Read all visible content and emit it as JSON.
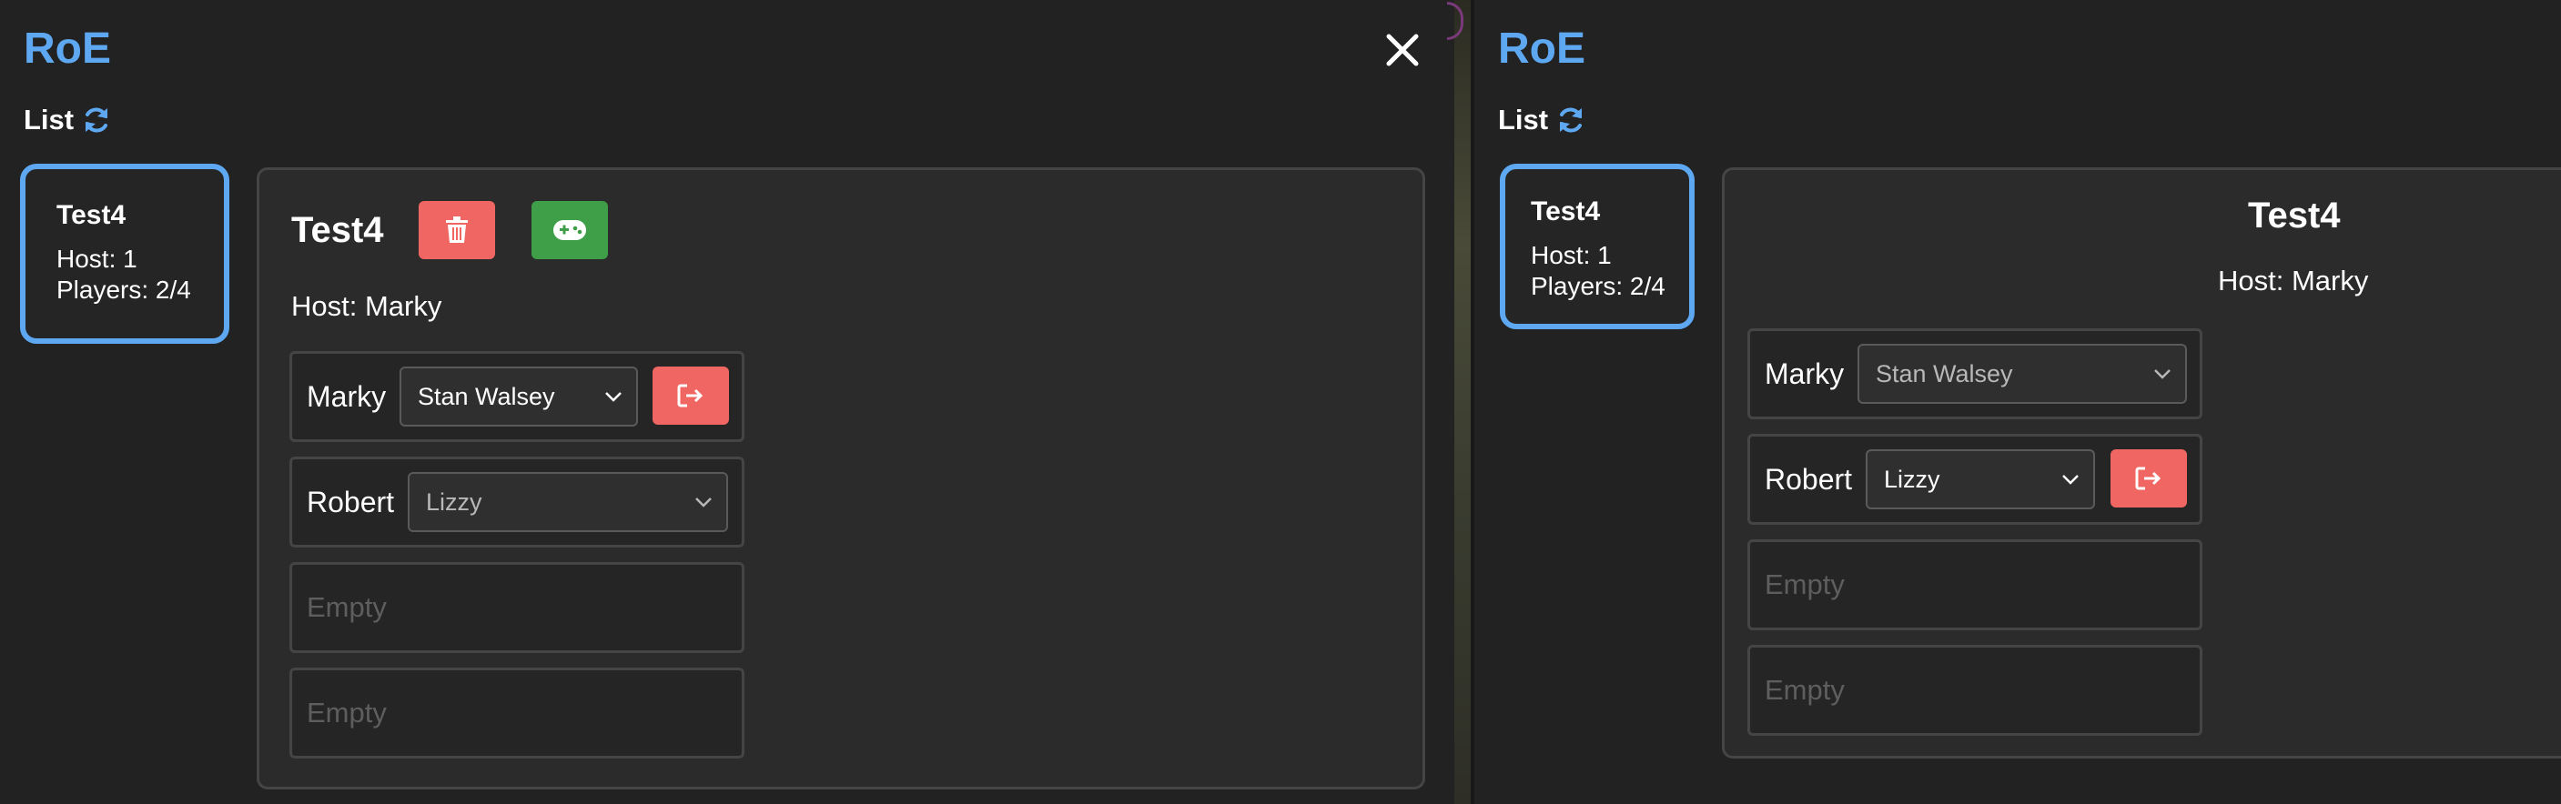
{
  "app": {
    "title": "RoE"
  },
  "list": {
    "label": "List"
  },
  "icons": {
    "refresh": "refresh-icon",
    "close": "close-icon",
    "delete": "trash-icon",
    "start": "gamepad-icon",
    "kick": "sign-out-icon",
    "dropdown": "chevron-down-icon"
  },
  "colors": {
    "accent": "#5ea8f2",
    "danger": "#ef6662",
    "success": "#3f9e48",
    "empty_text": "#5e5e5e"
  },
  "left": {
    "game_card": {
      "name": "Test4",
      "host": "Host: 1",
      "players": "Players: 2/4"
    },
    "detail": {
      "title": "Test4",
      "host": "Host: Marky",
      "slots": [
        {
          "player": "Marky",
          "selected": "Stan Walsey"
        },
        {
          "player": "Robert",
          "selected": "Lizzy"
        },
        {
          "empty": "Empty"
        },
        {
          "empty": "Empty"
        }
      ]
    }
  },
  "right": {
    "game_card": {
      "name": "Test4",
      "host": "Host: 1",
      "players": "Players: 2/4"
    },
    "detail": {
      "title": "Test4",
      "host": "Host: Marky",
      "slots": [
        {
          "player": "Marky",
          "selected": "Stan Walsey"
        },
        {
          "player": "Robert",
          "selected": "Lizzy"
        },
        {
          "empty": "Empty"
        },
        {
          "empty": "Empty"
        }
      ]
    }
  }
}
